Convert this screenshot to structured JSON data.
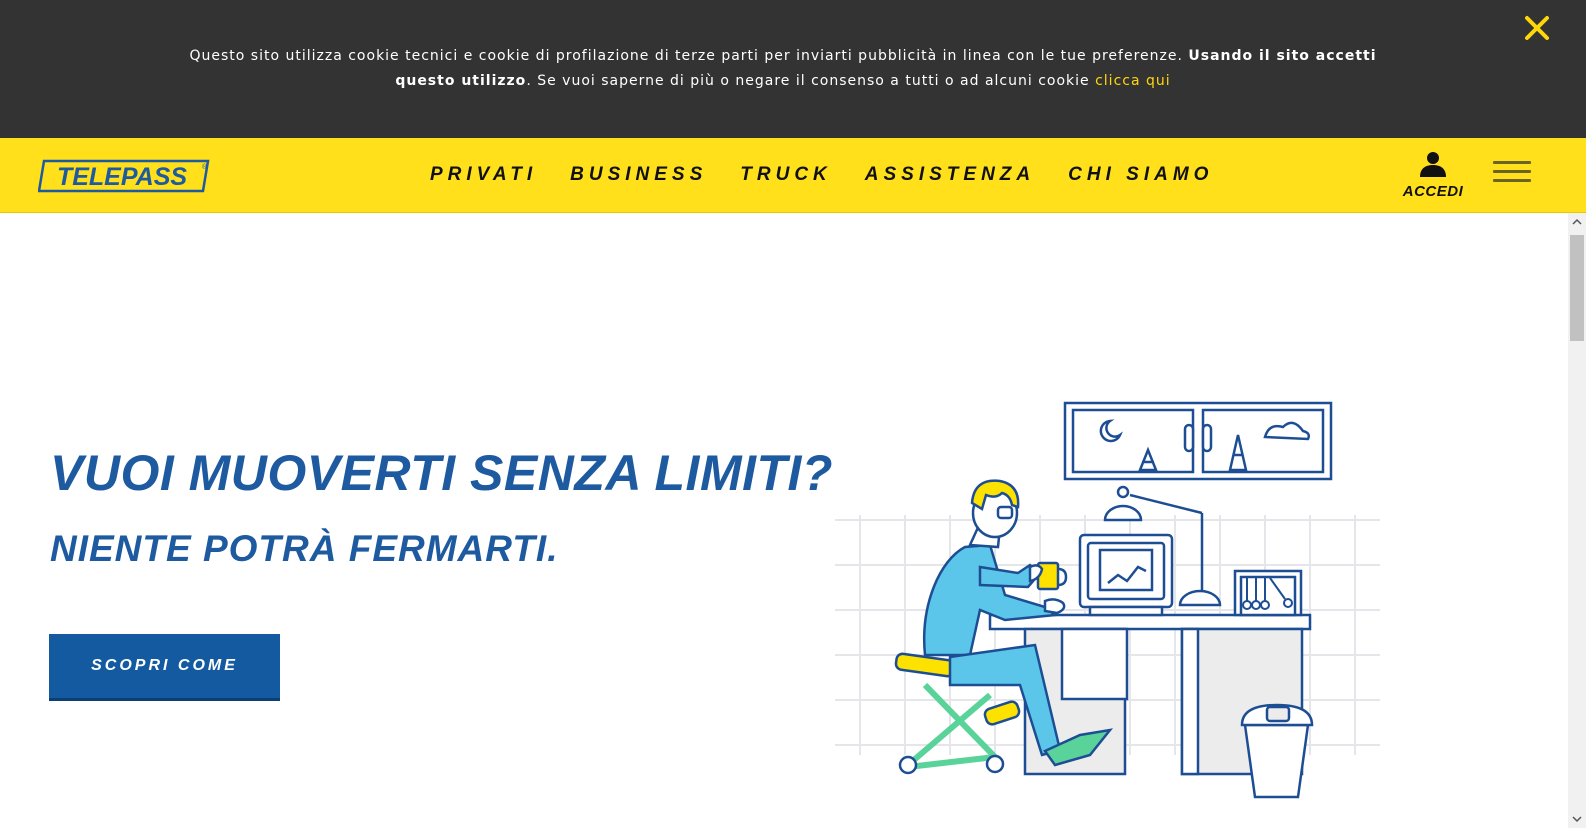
{
  "cookie_banner": {
    "text_part1": "Questo sito utilizza cookie tecnici e cookie di profilazione di terze parti per inviarti pubblicità in linea con le tue preferenze.",
    "text_bold": "Usando il sito accetti questo utilizzo",
    "text_part2": ". Se vuoi saperne di più o negare il consenso a tutti o ad alcuni cookie",
    "link_label": "clicca qui",
    "close_icon": "close-icon"
  },
  "header": {
    "logo_text": "TELEPASS",
    "nav": [
      {
        "label": "PRIVATI"
      },
      {
        "label": "BUSINESS"
      },
      {
        "label": "TRUCK"
      },
      {
        "label": "ASSISTENZA"
      },
      {
        "label": "CHI SIAMO"
      }
    ],
    "login_label": "ACCEDI",
    "login_icon": "user-icon",
    "menu_icon": "hamburger-icon"
  },
  "hero": {
    "title": "VUOI MUOVERTI SENZA LIMITI?",
    "subtitle": "NIENTE POTRÀ FERMARTI.",
    "cta_label": "SCOPRI COME"
  },
  "colors": {
    "cookie_bg": "#333333",
    "cookie_link": "#ffd60a",
    "header_bg": "#ffe01b",
    "brand_blue": "#1e5aa0",
    "cta_bg": "#135aa0"
  }
}
